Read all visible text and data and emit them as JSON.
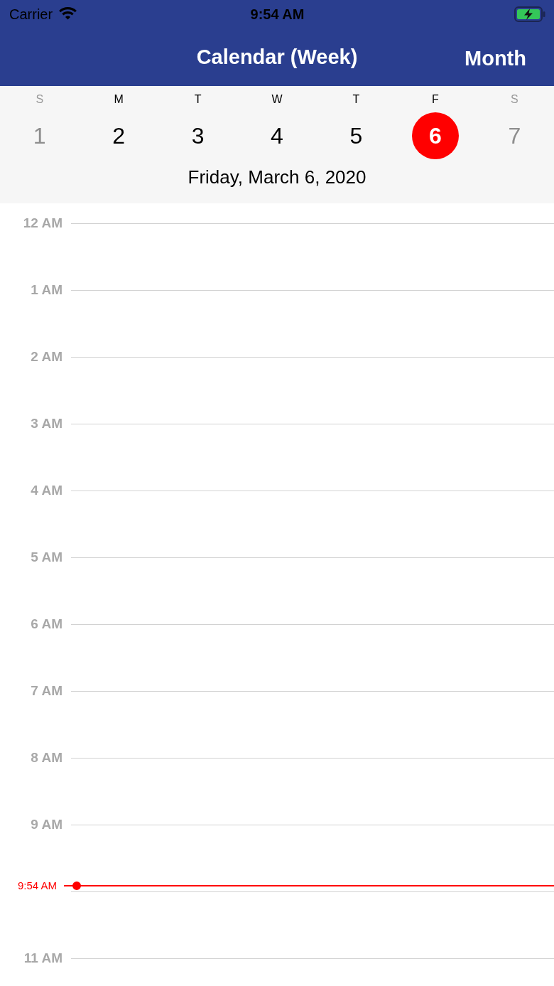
{
  "status_bar": {
    "carrier": "Carrier",
    "time": "9:54 AM",
    "battery_charging": true
  },
  "nav_bar": {
    "title": "Calendar (Week)",
    "right_button": "Month"
  },
  "week": {
    "days": [
      {
        "letter": "S",
        "number": "1",
        "weekend": true,
        "selected": false
      },
      {
        "letter": "M",
        "number": "2",
        "weekend": false,
        "selected": false
      },
      {
        "letter": "T",
        "number": "3",
        "weekend": false,
        "selected": false
      },
      {
        "letter": "W",
        "number": "4",
        "weekend": false,
        "selected": false
      },
      {
        "letter": "T",
        "number": "5",
        "weekend": false,
        "selected": false
      },
      {
        "letter": "F",
        "number": "6",
        "weekend": false,
        "selected": true
      },
      {
        "letter": "S",
        "number": "7",
        "weekend": true,
        "selected": false
      }
    ],
    "selected_date": "Friday, March 6, 2020"
  },
  "timeline": {
    "hours": [
      {
        "kind": "hour",
        "label": "12 AM"
      },
      {
        "kind": "hour",
        "label": "1 AM"
      },
      {
        "kind": "hour",
        "label": "2 AM"
      },
      {
        "kind": "hour",
        "label": "3 AM"
      },
      {
        "kind": "hour",
        "label": "4 AM"
      },
      {
        "kind": "hour",
        "label": "5 AM"
      },
      {
        "kind": "hour",
        "label": "6 AM"
      },
      {
        "kind": "hour",
        "label": "7 AM"
      },
      {
        "kind": "hour",
        "label": "8 AM"
      },
      {
        "kind": "hour",
        "label": "9 AM",
        "now": "9:54 AM"
      },
      {
        "kind": "gridline"
      },
      {
        "kind": "hour",
        "label": "11 AM"
      }
    ]
  }
}
